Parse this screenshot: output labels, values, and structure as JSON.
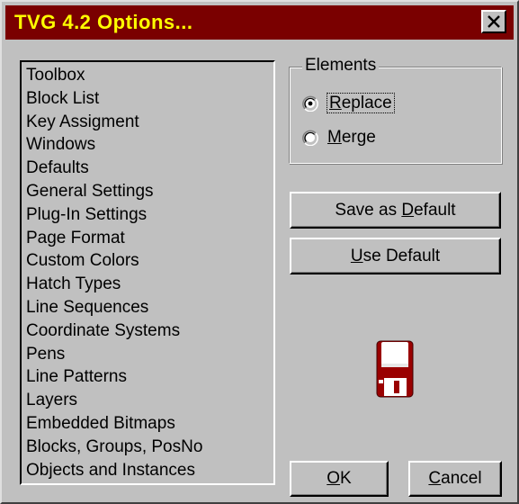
{
  "window": {
    "title": "TVG 4.2 Options...",
    "title_bar_color": "#7a0000",
    "title_text_color": "#ffff00",
    "close_icon": "close-icon"
  },
  "options_list": {
    "items": [
      {
        "label": "Toolbox"
      },
      {
        "label": "Block List"
      },
      {
        "label": "Key Assigment"
      },
      {
        "label": "Windows"
      },
      {
        "label": "Defaults"
      },
      {
        "label": "General Settings"
      },
      {
        "label": "Plug-In Settings"
      },
      {
        "label": "Page Format"
      },
      {
        "label": "Custom Colors"
      },
      {
        "label": "Hatch Types"
      },
      {
        "label": "Line Sequences"
      },
      {
        "label": "Coordinate Systems"
      },
      {
        "label": "Pens"
      },
      {
        "label": "Line Patterns"
      },
      {
        "label": "Layers"
      },
      {
        "label": "Embedded Bitmaps"
      },
      {
        "label": "Blocks, Groups, PosNo"
      },
      {
        "label": "Objects and Instances"
      }
    ]
  },
  "elements_group": {
    "legend": "Elements",
    "options": [
      {
        "accel": "R",
        "rest": "eplace",
        "selected": true
      },
      {
        "accel": "M",
        "rest": "erge",
        "selected": false
      }
    ]
  },
  "buttons": {
    "save_default": {
      "before": "Save as ",
      "accel": "D",
      "after": "efault"
    },
    "use_default": {
      "accel": "U",
      "after": "se Default"
    },
    "ok": {
      "accel": "O",
      "after": "K"
    },
    "cancel": {
      "accel": "C",
      "after": "ancel"
    }
  },
  "icons": {
    "floppy": "floppy-disk-icon",
    "floppy_color": "#9a0000"
  }
}
